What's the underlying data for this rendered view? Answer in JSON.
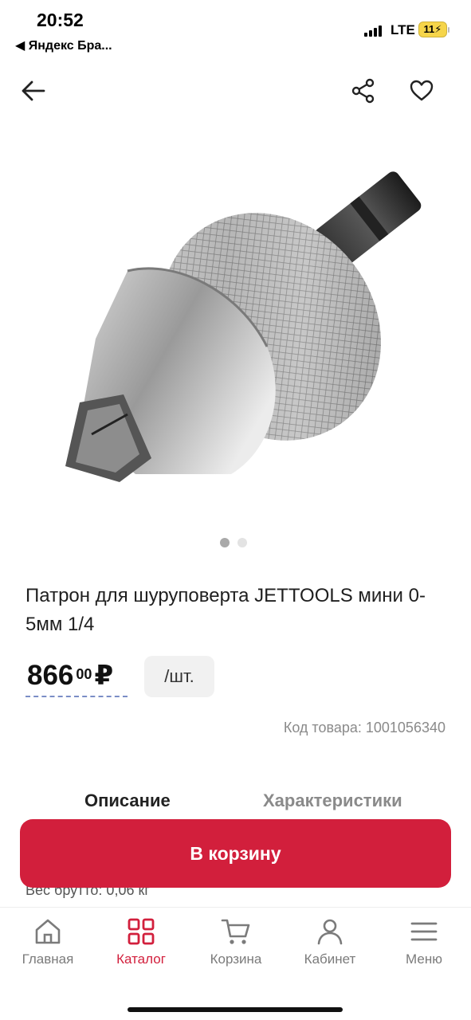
{
  "status_bar": {
    "time": "20:52",
    "back_app": "◀ Яндекс Бра...",
    "network": "LTE",
    "battery": "11"
  },
  "header": {
    "back_icon": "arrow-left-icon",
    "share_icon": "share-icon",
    "favorite_icon": "heart-icon"
  },
  "gallery": {
    "image_alt": "keyless drill chuck with hex shank",
    "slides": 2,
    "active_slide": 1
  },
  "product": {
    "title": "Патрон для шуруповерта JETTOOLS мини 0-5мм 1/4",
    "price_main": "866",
    "price_cents": "00",
    "currency": "₽",
    "unit": "/шт.",
    "sku_label": "Код товара: 1001056340"
  },
  "tabs": [
    {
      "label": "Описание",
      "active": true
    },
    {
      "label": "Характеристики",
      "active": false
    }
  ],
  "details": {
    "weight": "Вес брутто: 0,06 кг"
  },
  "cart_button": {
    "label": "В корзину",
    "color": "#d21f3c"
  },
  "bottom_nav": {
    "items": [
      {
        "label": "Главная",
        "icon": "home-icon",
        "active": false
      },
      {
        "label": "Каталог",
        "icon": "grid-icon",
        "active": true
      },
      {
        "label": "Корзина",
        "icon": "cart-icon",
        "active": false
      },
      {
        "label": "Кабинет",
        "icon": "user-icon",
        "active": false
      },
      {
        "label": "Меню",
        "icon": "menu-icon",
        "active": false
      }
    ]
  },
  "colors": {
    "accent": "#d21f3c",
    "text": "#1f1f1f",
    "muted": "#8a8a8a"
  }
}
